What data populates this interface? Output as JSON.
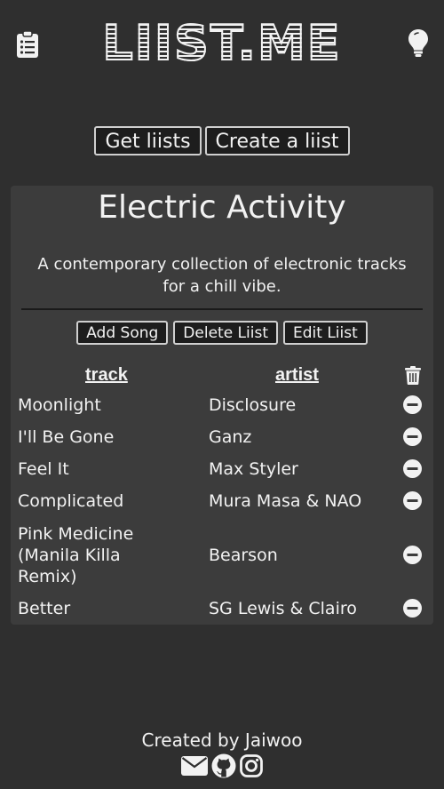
{
  "header": {
    "logo_text": "LIIST.ME",
    "left_icon": "clipboard-list-icon",
    "right_icon": "lightbulb-icon"
  },
  "nav": {
    "get_liists": "Get liists",
    "create_liist": "Create a liist"
  },
  "liist": {
    "title": "Electric Activity",
    "description": "A contemporary collection of electronic tracks for a chill vibe.",
    "actions": {
      "add_song": "Add Song",
      "delete_liist": "Delete Liist",
      "edit_liist": "Edit Liist"
    },
    "columns": {
      "track": "track",
      "artist": "artist",
      "delete_all_icon": "trash-icon"
    },
    "songs": [
      {
        "track": "Moonlight",
        "artist": "Disclosure"
      },
      {
        "track": "I'll Be Gone",
        "artist": "Ganz"
      },
      {
        "track": "Feel It",
        "artist": "Max Styler"
      },
      {
        "track": "Complicated",
        "artist": "Mura Masa & NAO"
      },
      {
        "track": "Pink Medicine (Manila Killa Remix)",
        "artist": "Bearson"
      },
      {
        "track": "Better",
        "artist": "SG Lewis & Clairo"
      }
    ],
    "remove_icon": "minus-circle-icon"
  },
  "footer": {
    "credit": "Created by Jaiwoo",
    "social_icons": [
      "envelope-icon",
      "github-icon",
      "instagram-icon"
    ]
  },
  "colors": {
    "background": "#2f2f2f",
    "card": "#3c3c3c",
    "button_bg": "#1d1d1d",
    "text": "#f2f2f2"
  }
}
